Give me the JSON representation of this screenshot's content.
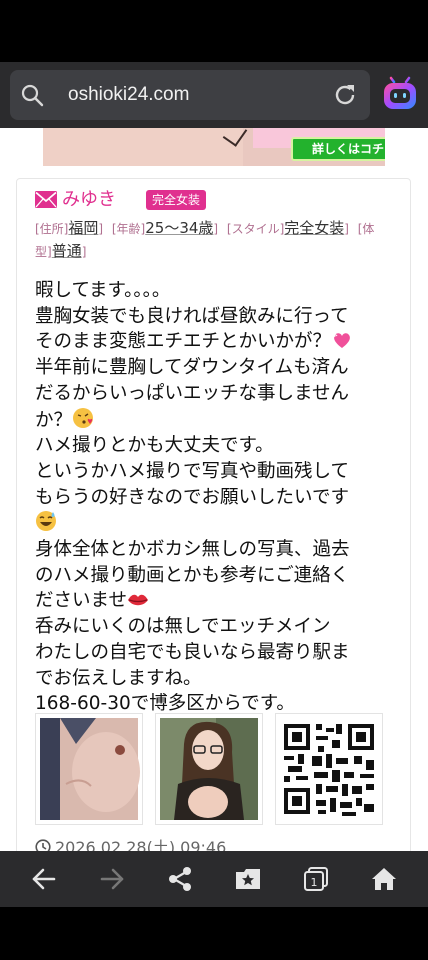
{
  "browser": {
    "url": "oshioki24.com"
  },
  "banner": {
    "button_label": "詳しくはコチラ"
  },
  "post": {
    "name": "みゆき",
    "badge": "完全女装",
    "attributes": {
      "address_label": "[住所]",
      "address_value": "福岡",
      "age_label": "[年齢]",
      "age_value": "25〜34歳",
      "style_label": "[スタイル]",
      "style_value": "完全女装",
      "body_label_part1": "[体",
      "body_label_part2": "型]",
      "body_value": "普通",
      "bracket_close": "]"
    },
    "body_lines": [
      "暇してます。。。。",
      "豊胸女装でも良ければ昼飲みに行って",
      "そのまま変態エチエチとかいかが？",
      "半年前に豊胸してダウンタイムも済ん",
      "だるからいっぱいエッチな事しません",
      "か？",
      "ハメ撮りとかも大丈夫です。",
      "というかハメ撮りで写真や動画残して",
      "もらうの好きなのでお願いしたいです",
      "",
      "身体全体とかボカシ無しの写真、過去",
      "のハメ撮り動画とかも参考にご連絡く",
      "ださいませ",
      "呑みにいくのは無しでエッチメイン",
      "わたしの自宅でも良いなら最寄り駅ま",
      "でお伝えしますね。",
      "168-60-30で博多区からです。"
    ],
    "date": "2026.02.28(土) 09:46"
  },
  "icons": {
    "search": "search-icon",
    "reload": "reload-icon",
    "assistant": "assistant-bot-icon",
    "mail": "mail-icon",
    "clock": "clock-icon",
    "back": "back-arrow-icon",
    "forward": "forward-arrow-icon",
    "share": "share-icon",
    "bookmarks": "bookmark-star-icon",
    "tabs": "tabs-icon",
    "home": "home-icon"
  },
  "nav": {
    "tab_count": "1"
  },
  "colors": {
    "accent_pink": "#e0308f",
    "toolbar_bg": "#2b2b2d",
    "banner_button_green": "#23b22d"
  }
}
